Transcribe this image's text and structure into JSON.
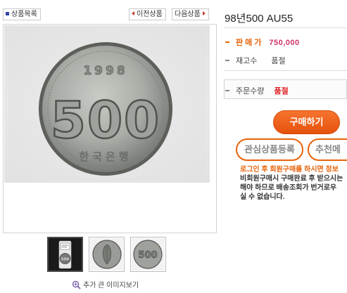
{
  "nav": {
    "list_label": "상품목록",
    "prev_label": "이전상품",
    "next_label": "다음상품"
  },
  "product": {
    "title": "98년500 AU55",
    "price_label": "판매가",
    "price_value": "750,000",
    "stock_label": "재고수",
    "stock_value": "품절",
    "qty_label": "주문수량",
    "qty_value": "품절"
  },
  "coin": {
    "year_text": "1998",
    "denomination": "500",
    "bottom_text": "한국은행"
  },
  "buttons": {
    "buy_label": "구매하기",
    "wishlist_label": "관심상품등록",
    "recommend_label": "추천메"
  },
  "notice": {
    "line1": "로그인 후 회원구매를 하시면 정보",
    "line2": "비회원구매시 구매완료 후 받으시는",
    "line3": "해야 하므로 배송조회가 번거로우",
    "line4": "실 수 없습니다."
  },
  "thumbnails": [
    {
      "name": "slab-thumbnail",
      "selected": true
    },
    {
      "name": "obverse-thumbnail",
      "selected": false
    },
    {
      "name": "reverse-thumbnail",
      "selected": false
    }
  ],
  "gallery": {
    "bigger_image_label": "추가 큰 이미지보기"
  },
  "colors": {
    "accent_orange": "#e8630a",
    "price_pink": "#d0336a",
    "soldout_red": "#e02020"
  }
}
